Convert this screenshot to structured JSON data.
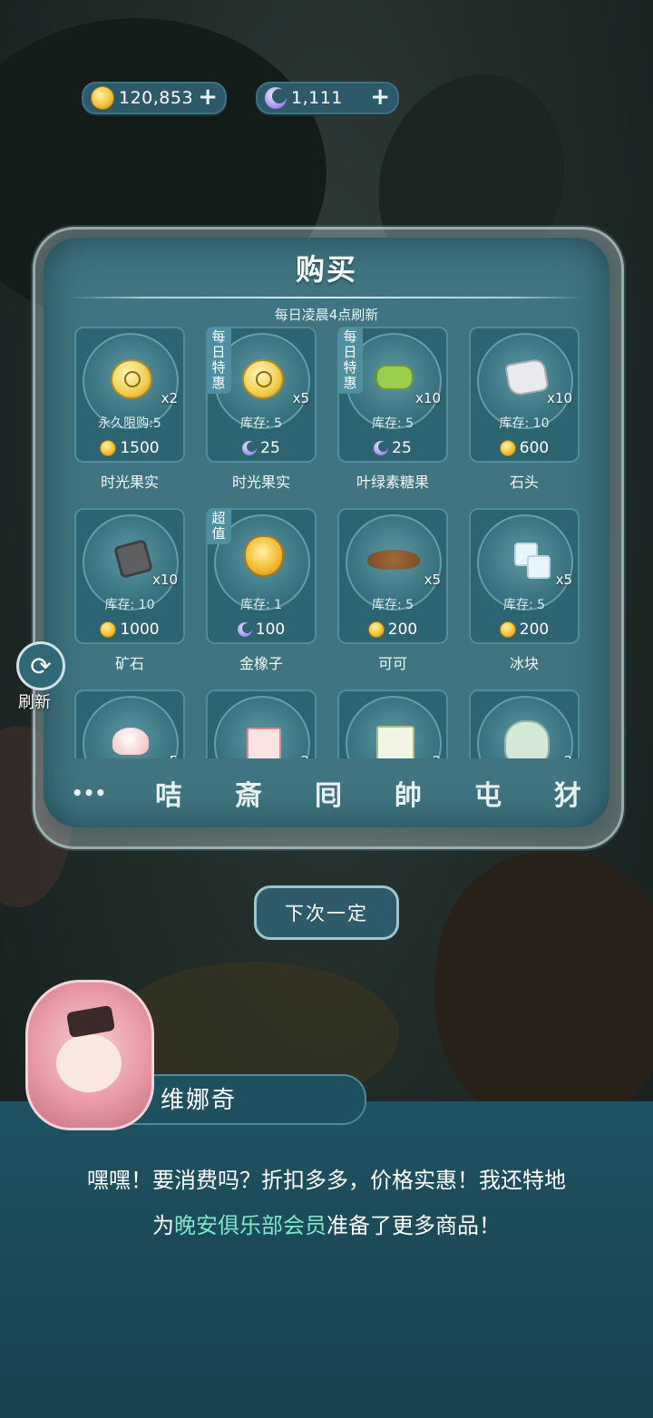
{
  "currency": {
    "coins": "120,853",
    "moons": "1,111",
    "add_label": "+"
  },
  "shop": {
    "title": "购买",
    "refresh_hint": "每日凌晨4点刷新",
    "items": [
      {
        "name": "时光果实",
        "qty": "x2",
        "stock": "永久限购:5",
        "price": "1500",
        "currency": "coin",
        "tag": "",
        "icon": "time-fruit-icon"
      },
      {
        "name": "时光果实",
        "qty": "x5",
        "stock": "库存: 5",
        "price": "25",
        "currency": "moon",
        "tag": "每日特惠",
        "icon": "time-fruit-icon"
      },
      {
        "name": "叶绿素糖果",
        "qty": "x10",
        "stock": "库存: 5",
        "price": "25",
        "currency": "moon",
        "tag": "每日特惠",
        "icon": "candy-icon"
      },
      {
        "name": "石头",
        "qty": "x10",
        "stock": "库存: 10",
        "price": "600",
        "currency": "coin",
        "tag": "",
        "icon": "stone-icon"
      },
      {
        "name": "矿石",
        "qty": "x10",
        "stock": "库存: 10",
        "price": "1000",
        "currency": "coin",
        "tag": "",
        "icon": "ore-icon"
      },
      {
        "name": "金橡子",
        "qty": "",
        "stock": "库存: 1",
        "price": "100",
        "currency": "moon",
        "tag": "超值",
        "icon": "golden-acorn-icon"
      },
      {
        "name": "可可",
        "qty": "x5",
        "stock": "库存: 5",
        "price": "200",
        "currency": "coin",
        "tag": "",
        "icon": "cocoa-icon"
      },
      {
        "name": "冰块",
        "qty": "x5",
        "stock": "库存: 5",
        "price": "200",
        "currency": "coin",
        "tag": "",
        "icon": "ice-cube-icon"
      },
      {
        "name": "",
        "qty": "5",
        "stock": "",
        "price": "",
        "currency": "",
        "tag": "",
        "icon": "cream-icon"
      },
      {
        "name": "",
        "qty": "2",
        "stock": "",
        "price": "",
        "currency": "",
        "tag": "",
        "icon": "seed-pack-icon"
      },
      {
        "name": "",
        "qty": "2",
        "stock": "",
        "price": "",
        "currency": "",
        "tag": "",
        "icon": "seed-bag-icon"
      },
      {
        "name": "",
        "qty": "2",
        "stock": "",
        "price": "",
        "currency": "",
        "tag": "",
        "icon": "flower-jar-icon"
      }
    ],
    "tabs": [
      {
        "name": "more-icon",
        "glyph": "•••"
      },
      {
        "name": "food-category-icon",
        "glyph": "咭"
      },
      {
        "name": "seed-category-icon",
        "glyph": "斎"
      },
      {
        "name": "furniture-category-icon",
        "glyph": "囘"
      },
      {
        "name": "flower-category-icon",
        "glyph": "帥"
      },
      {
        "name": "plant-category-icon",
        "glyph": "屯"
      },
      {
        "name": "clothing-category-icon",
        "glyph": "犲"
      }
    ]
  },
  "refresh": {
    "label": "刷新",
    "glyph": "⟳"
  },
  "next_button": {
    "label": "下次一定"
  },
  "npc": {
    "name": "维娜奇",
    "line1": "嘿嘿！要消费吗？折扣多多，价格实惠！我还特地",
    "line2_prefix": "为",
    "line2_highlight": "晚安俱乐部会员",
    "line2_suffix": "准备了更多商品！"
  },
  "colors": {
    "highlight": "#7fe6c9",
    "panel": "#3f7480",
    "card": "#2c6472"
  }
}
